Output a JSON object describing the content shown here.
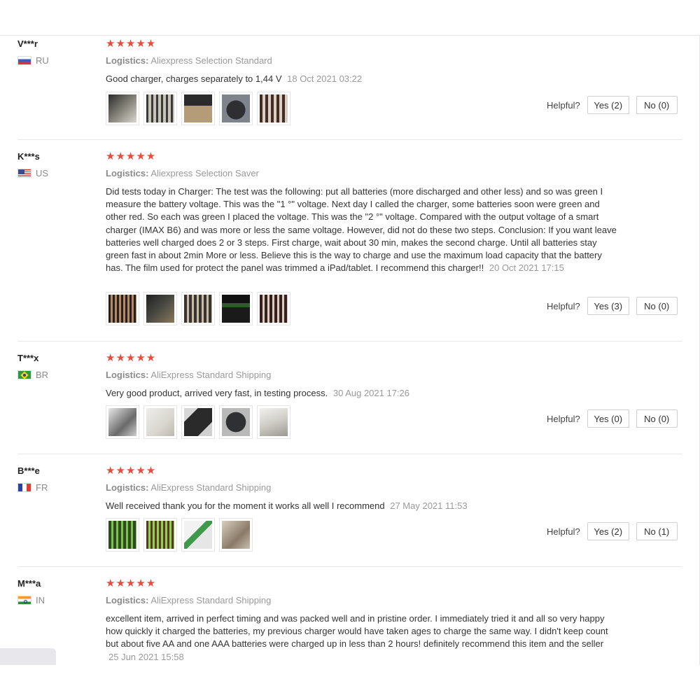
{
  "helpful_label": "Helpful?",
  "logistics_label": "Logistics:",
  "stars": "★★★★★",
  "colors": {
    "star": "#e94b3c",
    "date": "#9a9a9a"
  },
  "reviews": [
    {
      "user": "V***r",
      "country": "RU",
      "flag": "ru",
      "logistics": "Aliexpress Selection Standard",
      "text": "Good charger, charges separately to 1,44 V",
      "date": "18 Oct 2021 03:22",
      "yes": "Yes (2)",
      "no": "No (0)",
      "thumbs": [
        "charger-photo",
        "batteries-photo",
        "charger-display-photo",
        "charger-box-photo",
        "batteries-row-photo"
      ]
    },
    {
      "user": "K***s",
      "country": "US",
      "flag": "us",
      "logistics": "Aliexpress Selection Saver",
      "text": "Did tests today in Charger: The test was the following: put all batteries (more discharged and other less) and so was green I measure the battery voltage. This was the \"1 °\" voltage. Next day I called the charger, some batteries soon were green and other red. So each was green I placed the voltage. This was the \"2 °\" voltage. Compared with the output voltage of a smart charger (IMAX B6) and was more or less the same voltage. However, did not do these two steps. Conclusion: If you want leave batteries well charged does 2 or 3 steps. First charge, wait about 30 min, makes the second charge. Until all batteries stay green fast in about 2min More or less. Believe this is the way to charge and use the maximum load capacity that the battery has. The film used for protect the panel was trimmed a iPad/tablet. I recommend this charger!!",
      "date": "20 Oct 2021 17:15",
      "yes": "Yes (3)",
      "no": "No (0)",
      "thumbs": [
        "charger-slots-photo",
        "charger-desk-photo",
        "charger-batteries-photo",
        "charger-green-photo",
        "charger-top-photo"
      ]
    },
    {
      "user": "T***x",
      "country": "BR",
      "flag": "br",
      "logistics": "AliExpress Standard Shipping",
      "text": "Very good product, arrived very fast, in testing process.",
      "date": "30 Aug 2021 17:26",
      "yes": "Yes (0)",
      "no": "No (0)",
      "thumbs": [
        "package-photo",
        "manual-photo",
        "charger-black-photo",
        "charger-box-photo",
        "manual-sheet-photo"
      ]
    },
    {
      "user": "B***e",
      "country": "FR",
      "flag": "fr",
      "logistics": "AliExpress Standard Shipping",
      "text": "Well received thank you for the moment it works all well I recommend",
      "date": "27 May 2021 11:53",
      "yes": "Yes (2)",
      "no": "No (1)",
      "thumbs": [
        "charger-green-photo",
        "batteries-green-photo",
        "charger-white-photo",
        "box-photo"
      ]
    },
    {
      "user": "M***a",
      "country": "IN",
      "flag": "in",
      "logistics": "AliExpress Standard Shipping",
      "text": "excellent item, arrived in perfect timing and was packed well and in pristine order. I immediately tried it and all so very happy how quickly it charged the batteries, my previous charger would have taken ages to charge the same way. I didn't keep count but about five AA and one AAA batteries were charged up in less than 2 hours! definitely recommend this item and the seller",
      "date": "25 Jun 2021 15:58"
    }
  ]
}
